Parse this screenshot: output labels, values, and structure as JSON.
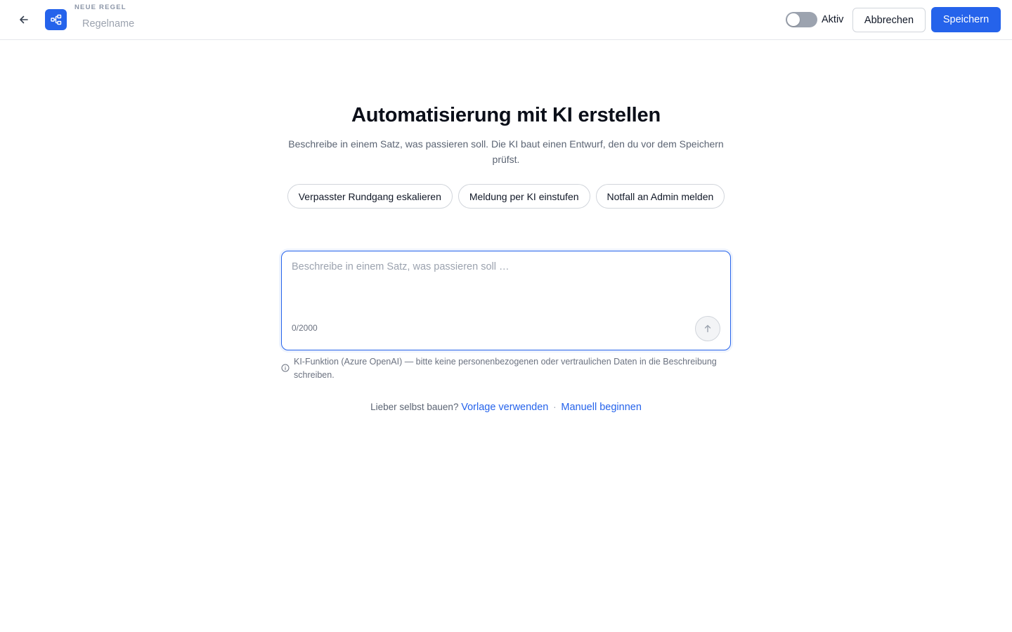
{
  "header": {
    "back_icon": "arrow-left-icon",
    "app_icon": "workflow-icon",
    "kicker": "NEUE REGEL",
    "name_placeholder": "Regelname",
    "name_value": "",
    "toggle": {
      "label": "Aktiv",
      "on": false
    },
    "cancel_label": "Abbrechen",
    "save_label": "Speichern",
    "accent_color": "#2563eb"
  },
  "main": {
    "title": "Automatisierung mit KI erstellen",
    "subtitle": "Beschreibe in einem Satz, was passieren soll. Die KI baut einen Entwurf, den du vor dem Speichern prüfst.",
    "suggestions": [
      "Verpasster Rundgang eskalieren",
      "Meldung per KI einstufen",
      "Notfall an Admin melden"
    ],
    "prompt": {
      "placeholder": "Beschreibe in einem Satz, was passieren soll …",
      "value": "",
      "counter": "0/2000",
      "send_icon": "arrow-up-icon"
    },
    "notice": {
      "icon": "info-icon",
      "text": "KI-Funktion (Azure OpenAI) — bitte keine personenbezogenen oder vertraulichen Daten in die Beschreibung schreiben."
    },
    "footer": {
      "prefix": "Lieber selbst bauen?",
      "template_link": "Vorlage verwenden",
      "separator": "·",
      "manual_link": "Manuell beginnen"
    }
  }
}
